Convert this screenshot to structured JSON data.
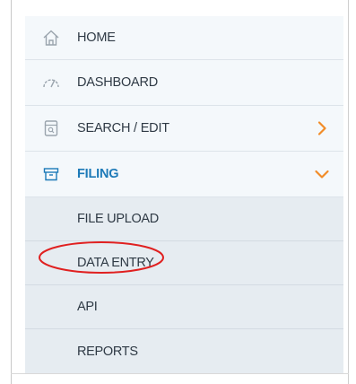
{
  "nav": {
    "items": [
      {
        "label": "HOME",
        "icon": "home-icon"
      },
      {
        "label": "DASHBOARD",
        "icon": "gauge-icon"
      },
      {
        "label": "SEARCH / EDIT",
        "icon": "search-document-icon",
        "chevron": "chevron-right-icon"
      },
      {
        "label": "FILING",
        "icon": "archive-box-icon",
        "chevron": "chevron-down-icon",
        "active": true
      }
    ],
    "submenu": [
      {
        "label": "FILE UPLOAD"
      },
      {
        "label": "DATA ENTRY",
        "highlighted": true
      },
      {
        "label": "API"
      },
      {
        "label": "REPORTS"
      }
    ]
  },
  "colors": {
    "item_background": "#f4f8fb",
    "submenu_background": "#e6ecf1",
    "active_text": "#1d7ab8",
    "chevron": "#f28c28",
    "annotation_ellipse": "#e02020"
  }
}
